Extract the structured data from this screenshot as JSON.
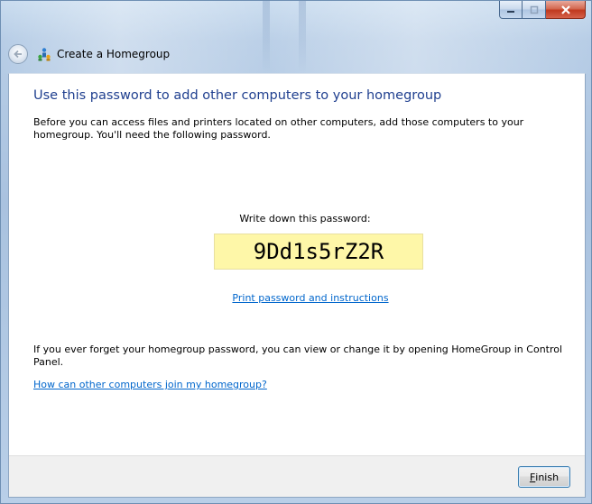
{
  "window": {
    "title": "Create a Homegroup",
    "caption_buttons": [
      "minimize",
      "maximize",
      "close"
    ]
  },
  "nav": {
    "back_icon": "back-arrow-icon",
    "app_icon": "homegroup-icon"
  },
  "main": {
    "heading": "Use this password to add other computers to your homegroup",
    "intro": "Before you can access files and printers located on other computers, add those computers to your homegroup. You'll need the following password.",
    "password_label": "Write down this password:",
    "password": "9Dd1s5rZ2R",
    "print_link": "Print password and instructions",
    "forget_text": "If you ever forget your homegroup password, you can view or change it by opening HomeGroup in Control Panel.",
    "help_link": "How can other computers join my homegroup?"
  },
  "footer": {
    "finish_accel": "F",
    "finish_rest": "inish"
  },
  "colors": {
    "heading": "#1f3f8f",
    "link": "#0066cc",
    "password_bg": "#fef7a8",
    "footer_bg": "#f0f0f0"
  }
}
